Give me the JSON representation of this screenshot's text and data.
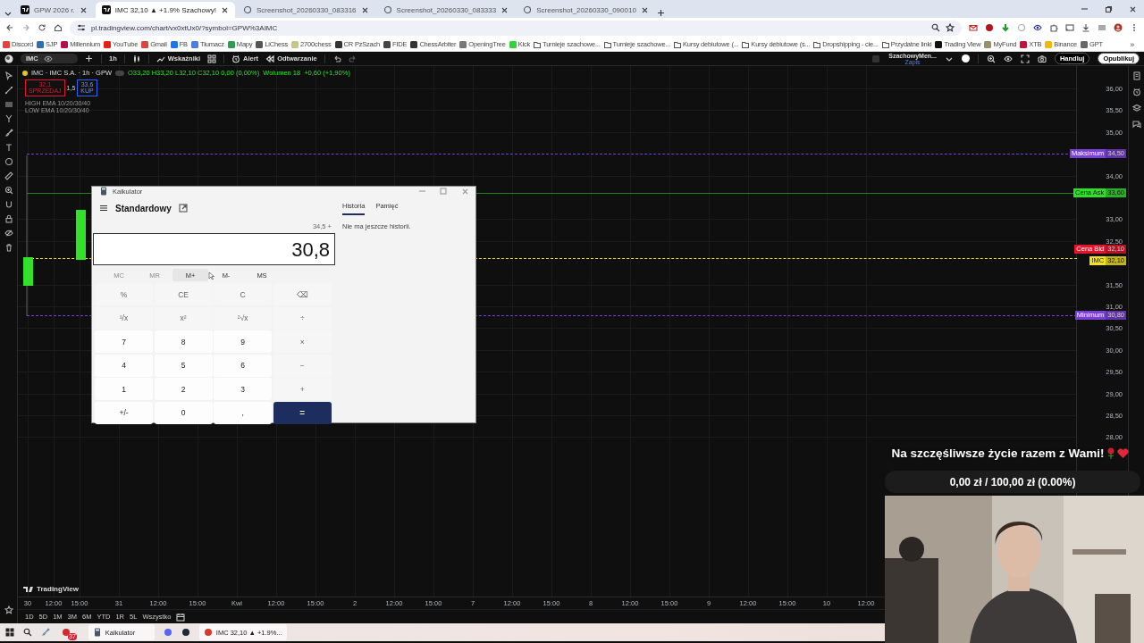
{
  "browser": {
    "tabs": [
      {
        "title": "GPW 2026 r.",
        "selected": false
      },
      {
        "title": "IMC 32,10 ▲ +1.9% Szachowy!",
        "selected": true
      },
      {
        "title": "Screenshot_20260330_083316",
        "selected": false
      },
      {
        "title": "Screenshot_20260330_083333",
        "selected": false
      },
      {
        "title": "Screenshot_20260330_090010",
        "selected": false
      }
    ],
    "address": "pl.tradingview.com/chart/vx0xtUx0/?symbol=GPW%3AIMC",
    "bookmarks": [
      {
        "label": "Discord",
        "kind": "site",
        "color": "#e8413c"
      },
      {
        "label": "SJP",
        "kind": "site",
        "color": "#2f6db5"
      },
      {
        "label": "Millennium",
        "kind": "site",
        "color": "#b0124f"
      },
      {
        "label": "YouTube",
        "kind": "site",
        "color": "#e62117"
      },
      {
        "label": "Gmail",
        "kind": "site",
        "color": "#d9463a"
      },
      {
        "label": "FB",
        "kind": "site",
        "color": "#1877f2"
      },
      {
        "label": "Tłumacz",
        "kind": "site",
        "color": "#4a7fe0"
      },
      {
        "label": "Mapy",
        "kind": "site",
        "color": "#2f9e4b"
      },
      {
        "label": "LiChess",
        "kind": "site",
        "color": "#555555"
      },
      {
        "label": "2700chess",
        "kind": "site",
        "color": "#c9c48a"
      },
      {
        "label": "CR PzSzach",
        "kind": "site",
        "color": "#333333"
      },
      {
        "label": "FIDE",
        "kind": "site",
        "color": "#444444"
      },
      {
        "label": "ChessArbiter",
        "kind": "site",
        "color": "#333333"
      },
      {
        "label": "OpeningTree",
        "kind": "site",
        "color": "#777777"
      },
      {
        "label": "Kick",
        "kind": "site",
        "color": "#2fd33a"
      },
      {
        "label": "Turnieje szachowe...",
        "kind": "folder"
      },
      {
        "label": "Turnieje szachowe...",
        "kind": "folder"
      },
      {
        "label": "Kursy debiutowe (...",
        "kind": "folder"
      },
      {
        "label": "Kursy debiutowe (s...",
        "kind": "folder"
      },
      {
        "label": "Dropshipping - cie...",
        "kind": "folder"
      },
      {
        "label": "Przydatne linki",
        "kind": "folder"
      },
      {
        "label": "Trading View",
        "kind": "site",
        "color": "#111111"
      },
      {
        "label": "MyFund",
        "kind": "site",
        "color": "#9a8f6a"
      },
      {
        "label": "XTB",
        "kind": "site",
        "color": "#c2123a"
      },
      {
        "label": "Binance",
        "kind": "site",
        "color": "#f0b90b"
      },
      {
        "label": "GPT",
        "kind": "site",
        "color": "#666666"
      }
    ],
    "more": "»"
  },
  "toolbar": {
    "symbol": "IMC",
    "interval": "1h",
    "indicators": "Wskaźniki",
    "alert": "Alert",
    "replay": "Odtwarzanie",
    "layout_name": "SzachowyMen...",
    "layout_sub": "Zapis",
    "trade": "Handluj",
    "publish": "Opublikuj"
  },
  "legend": {
    "title": "IMC · IMC S.A. · 1h · GPW",
    "ohlc": "O33,20 H33,20 L32,10 C32,10 0,00 (0,00%)",
    "volume": "Wolumen 18",
    "change": "+0,60 (+1,90%)",
    "sell": {
      "price": "32,1",
      "label": "SPRZEDAJ"
    },
    "spread": "1,5",
    "buy": {
      "price": "33,6",
      "label": "KUP"
    },
    "indicators": [
      "HIGH EMA 10/20/30/40",
      "LOW EMA 10/20/30/40"
    ]
  },
  "price_axis": [
    "36,00",
    "35,50",
    "35,00",
    "34,00",
    "33,00",
    "32,50",
    "31,50",
    "31,00",
    "30,50",
    "30,00",
    "29,50",
    "29,00",
    "28,50",
    "28,00"
  ],
  "price_tags": [
    {
      "label": "Maksimum",
      "value": "34,50",
      "color": "#7a3fd6"
    },
    {
      "label": "Cena Ask",
      "value": "33,60",
      "color": "#2fe02a"
    },
    {
      "label": "Cena Bid",
      "value": "32,10",
      "color": "#e3142b"
    },
    {
      "label": "IMC",
      "value": "32,10",
      "color": "#f2e21c"
    },
    {
      "label": "Minimum",
      "value": "30,80",
      "color": "#7a3fd6"
    }
  ],
  "brand": "TradingView",
  "time_axis": [
    "30",
    "12:00",
    "15:00",
    "31",
    "12:00",
    "15:00",
    "Kwi",
    "12:00",
    "15:00",
    "2",
    "12:00",
    "15:00",
    "7",
    "12:00",
    "15:00",
    "8",
    "12:00",
    "15:00",
    "9",
    "12:00",
    "15:00",
    "10",
    "12:00"
  ],
  "ranges": [
    "1D",
    "5D",
    "1M",
    "3M",
    "6M",
    "YTD",
    "1R",
    "5L",
    "Wszystko"
  ],
  "calculator": {
    "title": "Kalkulator",
    "mode": "Standardowy",
    "expression": "34,5 +",
    "display": "30,8",
    "memory": [
      {
        "label": "MC",
        "disabled": true,
        "hover": false
      },
      {
        "label": "MR",
        "disabled": true,
        "hover": false
      },
      {
        "label": "M+",
        "disabled": false,
        "hover": true
      },
      {
        "label": "M-",
        "disabled": false,
        "hover": false
      },
      {
        "label": "MS",
        "disabled": false,
        "hover": false
      }
    ],
    "keys": [
      {
        "label": "%",
        "kind": "fn"
      },
      {
        "label": "CE",
        "kind": "fn"
      },
      {
        "label": "C",
        "kind": "fn"
      },
      {
        "label": "⌫",
        "kind": "fn"
      },
      {
        "label": "¹/x",
        "kind": "fn"
      },
      {
        "label": "x²",
        "kind": "fn"
      },
      {
        "label": "²√x",
        "kind": "fn"
      },
      {
        "label": "÷",
        "kind": "fn"
      },
      {
        "label": "7",
        "kind": "digit"
      },
      {
        "label": "8",
        "kind": "digit"
      },
      {
        "label": "9",
        "kind": "digit"
      },
      {
        "label": "×",
        "kind": "fn"
      },
      {
        "label": "4",
        "kind": "digit"
      },
      {
        "label": "5",
        "kind": "digit"
      },
      {
        "label": "6",
        "kind": "digit"
      },
      {
        "label": "−",
        "kind": "fn"
      },
      {
        "label": "1",
        "kind": "digit"
      },
      {
        "label": "2",
        "kind": "digit"
      },
      {
        "label": "3",
        "kind": "digit"
      },
      {
        "label": "+",
        "kind": "fn"
      },
      {
        "label": "+/-",
        "kind": "digit"
      },
      {
        "label": "0",
        "kind": "digit"
      },
      {
        "label": ",",
        "kind": "digit"
      },
      {
        "label": "=",
        "kind": "equals"
      }
    ],
    "tabs": [
      {
        "label": "Historia",
        "selected": true
      },
      {
        "label": "Pamięć",
        "selected": false
      }
    ],
    "empty_history": "Nie ma jeszcze historii."
  },
  "overlay": {
    "title": "Na szczęśliwsze życie razem z Wami!",
    "progress_text": "0,00 zł / 100,00 zł (0.00%)",
    "level": 0
  },
  "taskbar": [
    {
      "kind": "start"
    },
    {
      "kind": "search"
    },
    {
      "kind": "app"
    },
    {
      "kind": "badge",
      "badge": "37"
    },
    {
      "kind": "window",
      "label": "Kalkulator"
    },
    {
      "kind": "discord"
    },
    {
      "kind": "steam"
    },
    {
      "kind": "window",
      "label": "IMC 32,10 ▲ +1.9%..."
    }
  ]
}
